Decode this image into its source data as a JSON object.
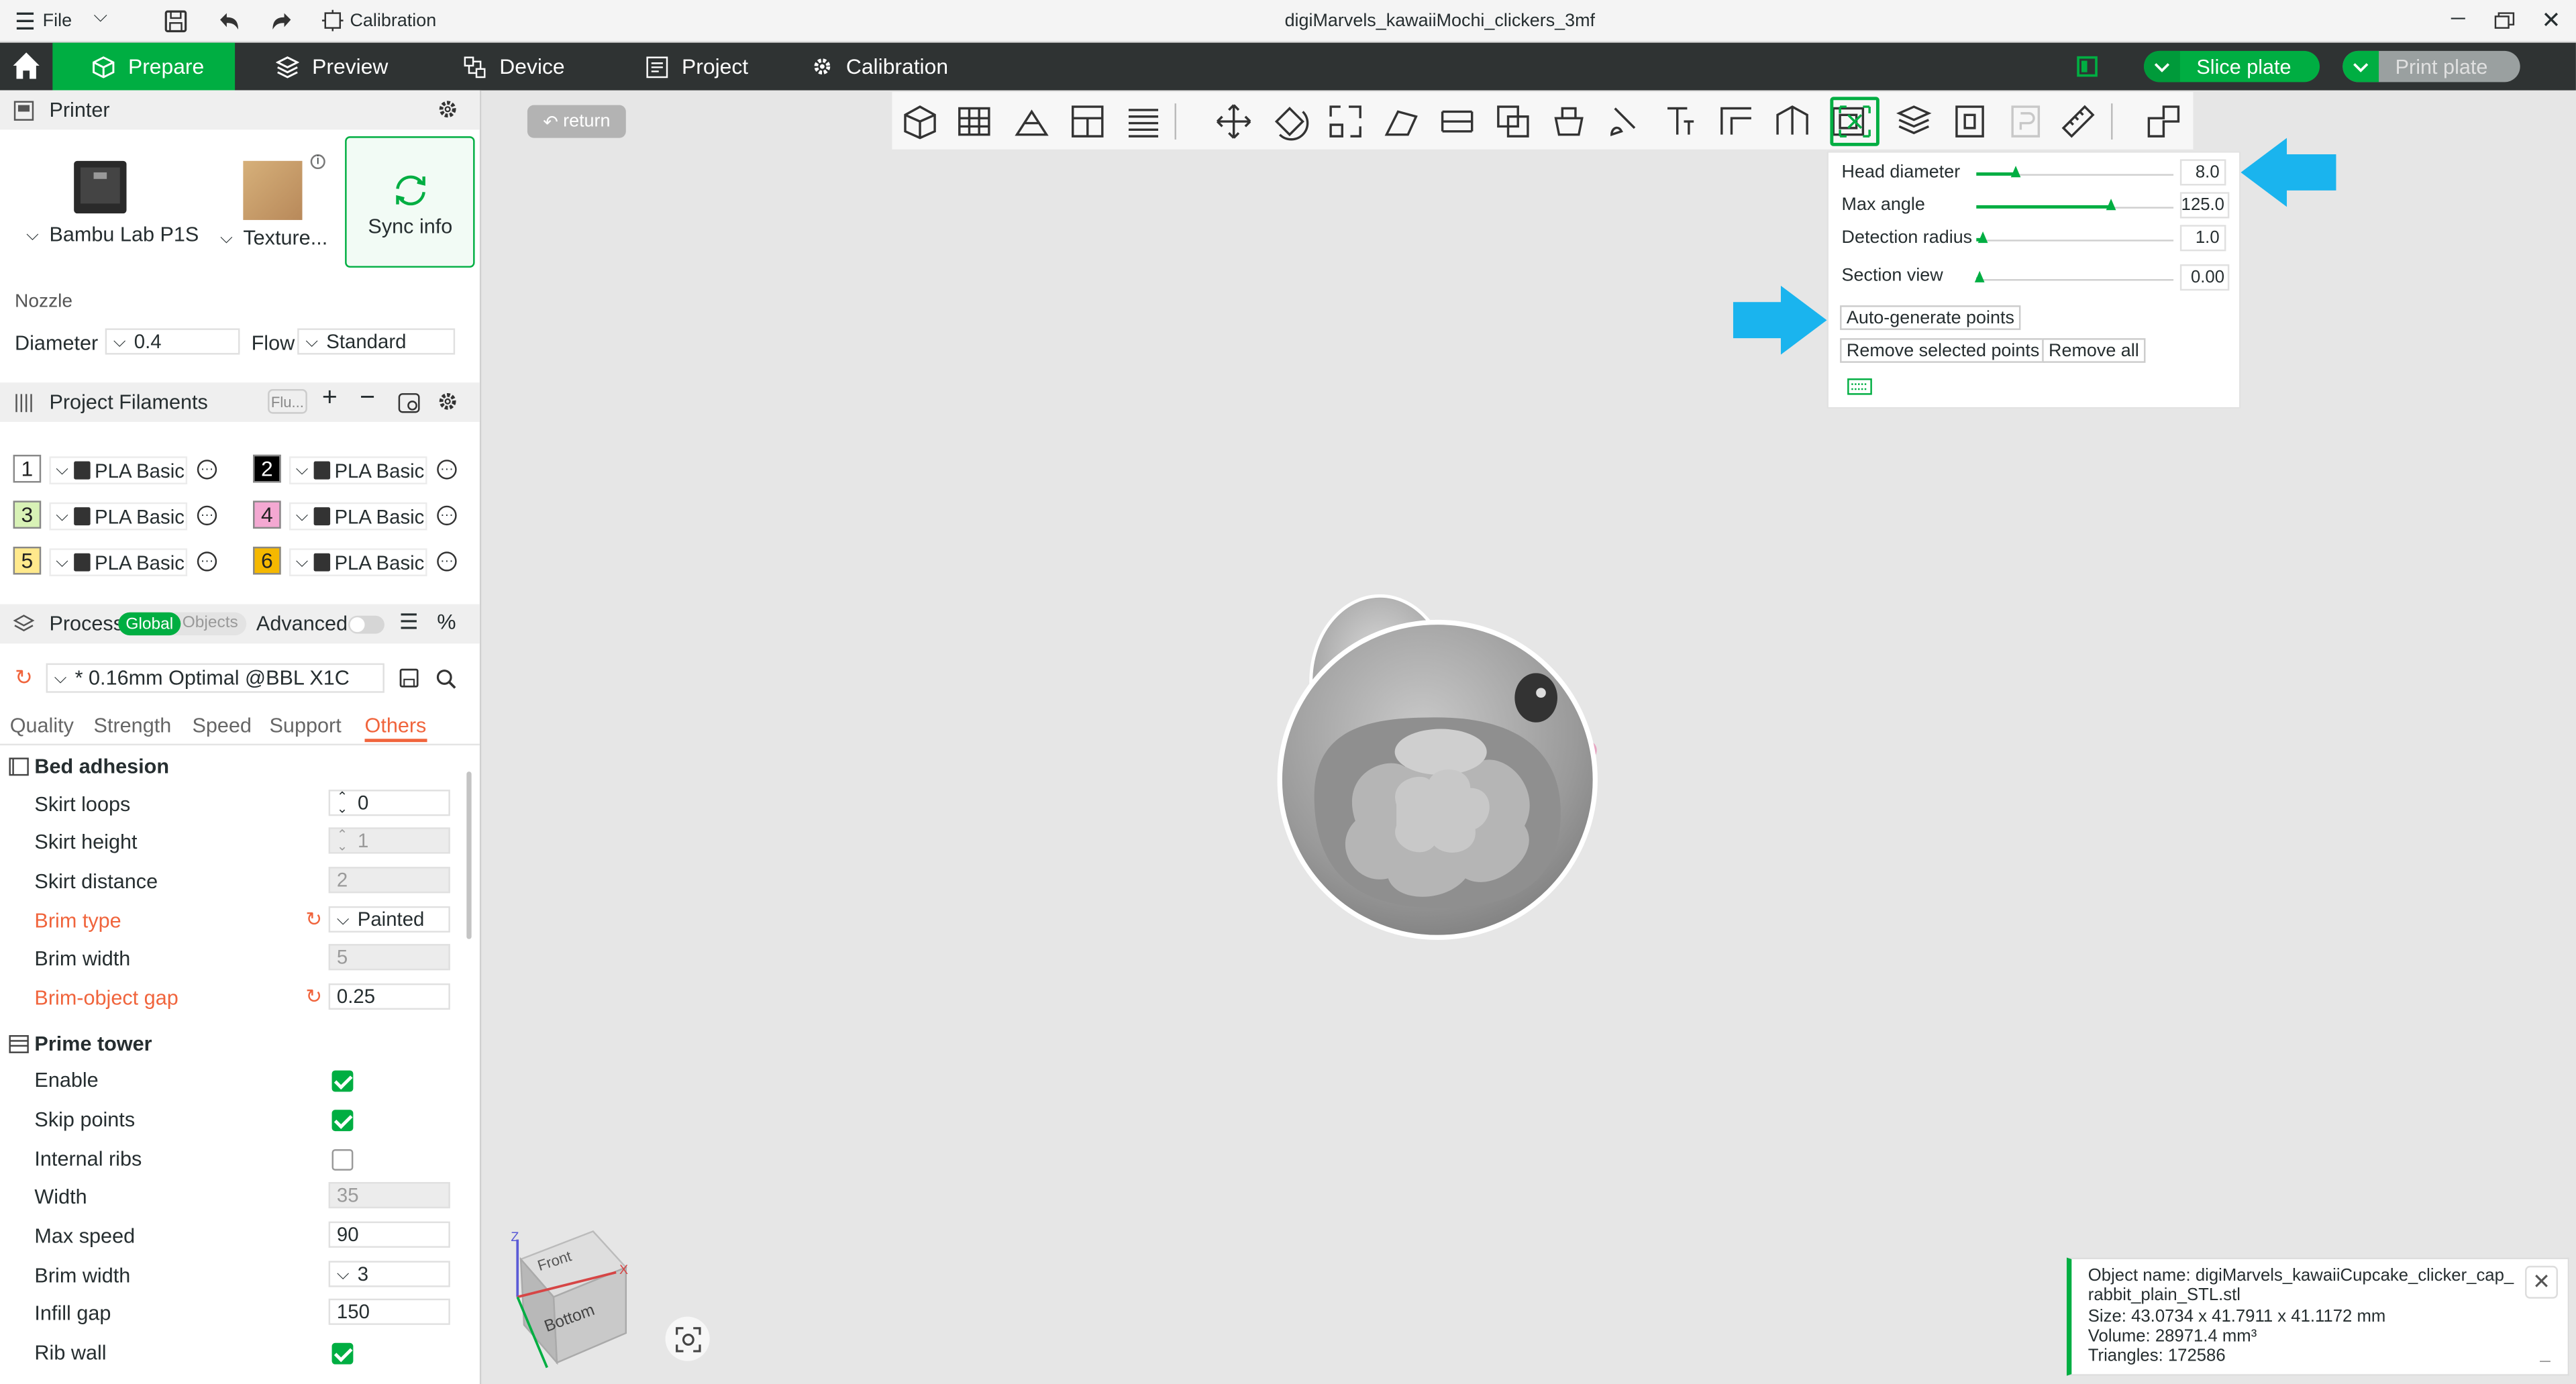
{
  "window": {
    "title": "digiMarvels_kawaiiMochi_clickers_3mf",
    "file_menu": "File",
    "calibration_shortcut": "Calibration"
  },
  "nav": {
    "tabs": [
      "Prepare",
      "Preview",
      "Device",
      "Project",
      "Calibration"
    ],
    "active_tab": "Prepare",
    "slice_plate": "Slice plate",
    "print_plate": "Print plate",
    "accent_color": "#00ae42"
  },
  "printer": {
    "header": "Printer",
    "printer_name": "Bambu Lab P1S",
    "plate_name": "Texture...",
    "sync_label": "Sync info",
    "nozzle_label": "Nozzle",
    "diameter_label": "Diameter",
    "diameter_value": "0.4",
    "flow_label": "Flow",
    "flow_value": "Standard"
  },
  "filaments": {
    "header": "Project Filaments",
    "flush_button": "Flu...",
    "items": [
      {
        "num": "1",
        "name": "PLA Basic",
        "color": "#ffffff",
        "text_color": "#222222"
      },
      {
        "num": "2",
        "name": "PLA Basic",
        "color": "#000000",
        "text_color": "#ffffff"
      },
      {
        "num": "3",
        "name": "PLA Basic",
        "color": "#d8f2b6",
        "text_color": "#222222"
      },
      {
        "num": "4",
        "name": "PLA Basic",
        "color": "#f4a8d2",
        "text_color": "#222222"
      },
      {
        "num": "5",
        "name": "PLA Basic",
        "color": "#ffe98c",
        "text_color": "#222222"
      },
      {
        "num": "6",
        "name": "PLA Basic",
        "color": "#f5b800",
        "text_color": "#222222"
      }
    ]
  },
  "process": {
    "header": "Process",
    "toggle_global": "Global",
    "toggle_objects": "Objects",
    "advanced_label": "Advanced",
    "preset": "* 0.16mm Optimal @BBL X1C",
    "tabs": [
      "Quality",
      "Strength",
      "Speed",
      "Support",
      "Others"
    ],
    "active_tab": "Others",
    "bed_adhesion": {
      "title": "Bed adhesion",
      "skirt_loops_label": "Skirt loops",
      "skirt_loops": "0",
      "skirt_height_label": "Skirt height",
      "skirt_height": "1",
      "skirt_distance_label": "Skirt distance",
      "skirt_distance": "2",
      "brim_type_label": "Brim type",
      "brim_type": "Painted",
      "brim_width_label": "Brim width",
      "brim_width": "5",
      "brim_gap_label": "Brim-object gap",
      "brim_gap": "0.25"
    },
    "prime_tower": {
      "title": "Prime tower",
      "enable_label": "Enable",
      "enable": true,
      "skip_points_label": "Skip points",
      "skip_points": true,
      "internal_ribs_label": "Internal ribs",
      "internal_ribs": false,
      "width_label": "Width",
      "width": "35",
      "max_speed_label": "Max speed",
      "max_speed": "90",
      "brim_width_label": "Brim width",
      "brim_width": "3",
      "infill_gap_label": "Infill gap",
      "infill_gap": "150",
      "rib_wall_label": "Rib wall",
      "rib_wall": true
    },
    "modified_color": "#f0643c"
  },
  "canvas": {
    "return_label": "return"
  },
  "support_panel": {
    "head_diameter_label": "Head diameter",
    "head_diameter": "8.0",
    "head_diameter_level": 0.2,
    "max_angle_label": "Max angle",
    "max_angle": "125.0",
    "max_angle_level": 0.68,
    "detection_radius_label": "Detection radius",
    "detection_radius": "1.0",
    "detection_radius_level": 0.03,
    "section_view_label": "Section view",
    "section_view": "0.00",
    "section_view_level": 0.02,
    "auto_generate": "Auto-generate points",
    "remove_selected": "Remove selected points",
    "remove_all": "Remove all"
  },
  "view_cube": {
    "front": "Front",
    "bottom": "Bottom",
    "axis_x": "X",
    "axis_z": "Z"
  },
  "object_info": {
    "name_line1": "Object name: digiMarvels_kawaiiCupcake_clicker_cap_",
    "name_line2": "rabbit_plain_STL.stl",
    "size": "Size: 43.0734 x 41.7911 x 41.1172 mm",
    "volume": "Volume: 28971.4 mm³",
    "triangles": "Triangles: 172586"
  },
  "annotation_color": "#1ab4ee"
}
